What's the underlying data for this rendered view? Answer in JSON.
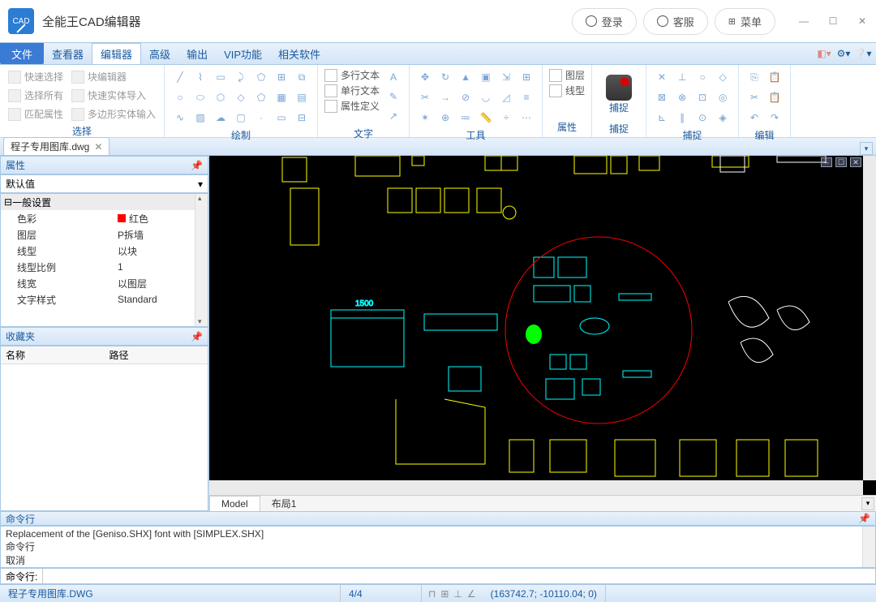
{
  "titlebar": {
    "app_name": "全能王CAD编辑器",
    "login": "登录",
    "support": "客服",
    "menu": "菜单"
  },
  "menubar": {
    "file": "文件",
    "tabs": [
      "查看器",
      "编辑器",
      "高级",
      "输出",
      "VIP功能",
      "相关软件"
    ],
    "active_index": 1
  },
  "ribbon": {
    "select": {
      "quick_select": "快速选择",
      "block_editor": "块编辑器",
      "select_all": "选择所有",
      "quick_import": "快速实体导入",
      "match_props": "匹配属性",
      "poly_import": "多边形实体输入",
      "label": "选择"
    },
    "draw_label": "绘制",
    "text": {
      "mtext": "多行文本",
      "stext": "单行文本",
      "attdef": "属性定义",
      "label": "文字"
    },
    "tools_label": "工具",
    "props": {
      "layer": "图层",
      "linetype": "线型",
      "label": "属性"
    },
    "capture_label": "捕捉",
    "capture_btn": "捕捉",
    "edit_label": "编辑"
  },
  "doctab": {
    "name": "程子专用图库.dwg"
  },
  "panels": {
    "props_title": "属性",
    "props_default": "默认值",
    "general": "一般设置",
    "rows": [
      {
        "k": "色彩",
        "v": "红色",
        "red": true
      },
      {
        "k": "图层",
        "v": "P拆墙"
      },
      {
        "k": "线型",
        "v": "以块"
      },
      {
        "k": "线型比例",
        "v": "1"
      },
      {
        "k": "线宽",
        "v": "以图层"
      },
      {
        "k": "文字样式",
        "v": "Standard"
      }
    ],
    "fav_title": "收藏夹",
    "fav_cols": [
      "名称",
      "路径"
    ]
  },
  "model_tabs": {
    "model": "Model",
    "layout": "布局1"
  },
  "cmd": {
    "title": "命令行",
    "line1": "Replacement of the [Geniso.SHX] font with [SIMPLEX.SHX]",
    "line2": "命令行",
    "line3": "取消",
    "prompt": "命令行:"
  },
  "status": {
    "file": "程子专用图库.DWG",
    "ratio": "4/4",
    "coords": "(163742.7; -10110.04; 0)"
  },
  "canvas_dim": "1500"
}
